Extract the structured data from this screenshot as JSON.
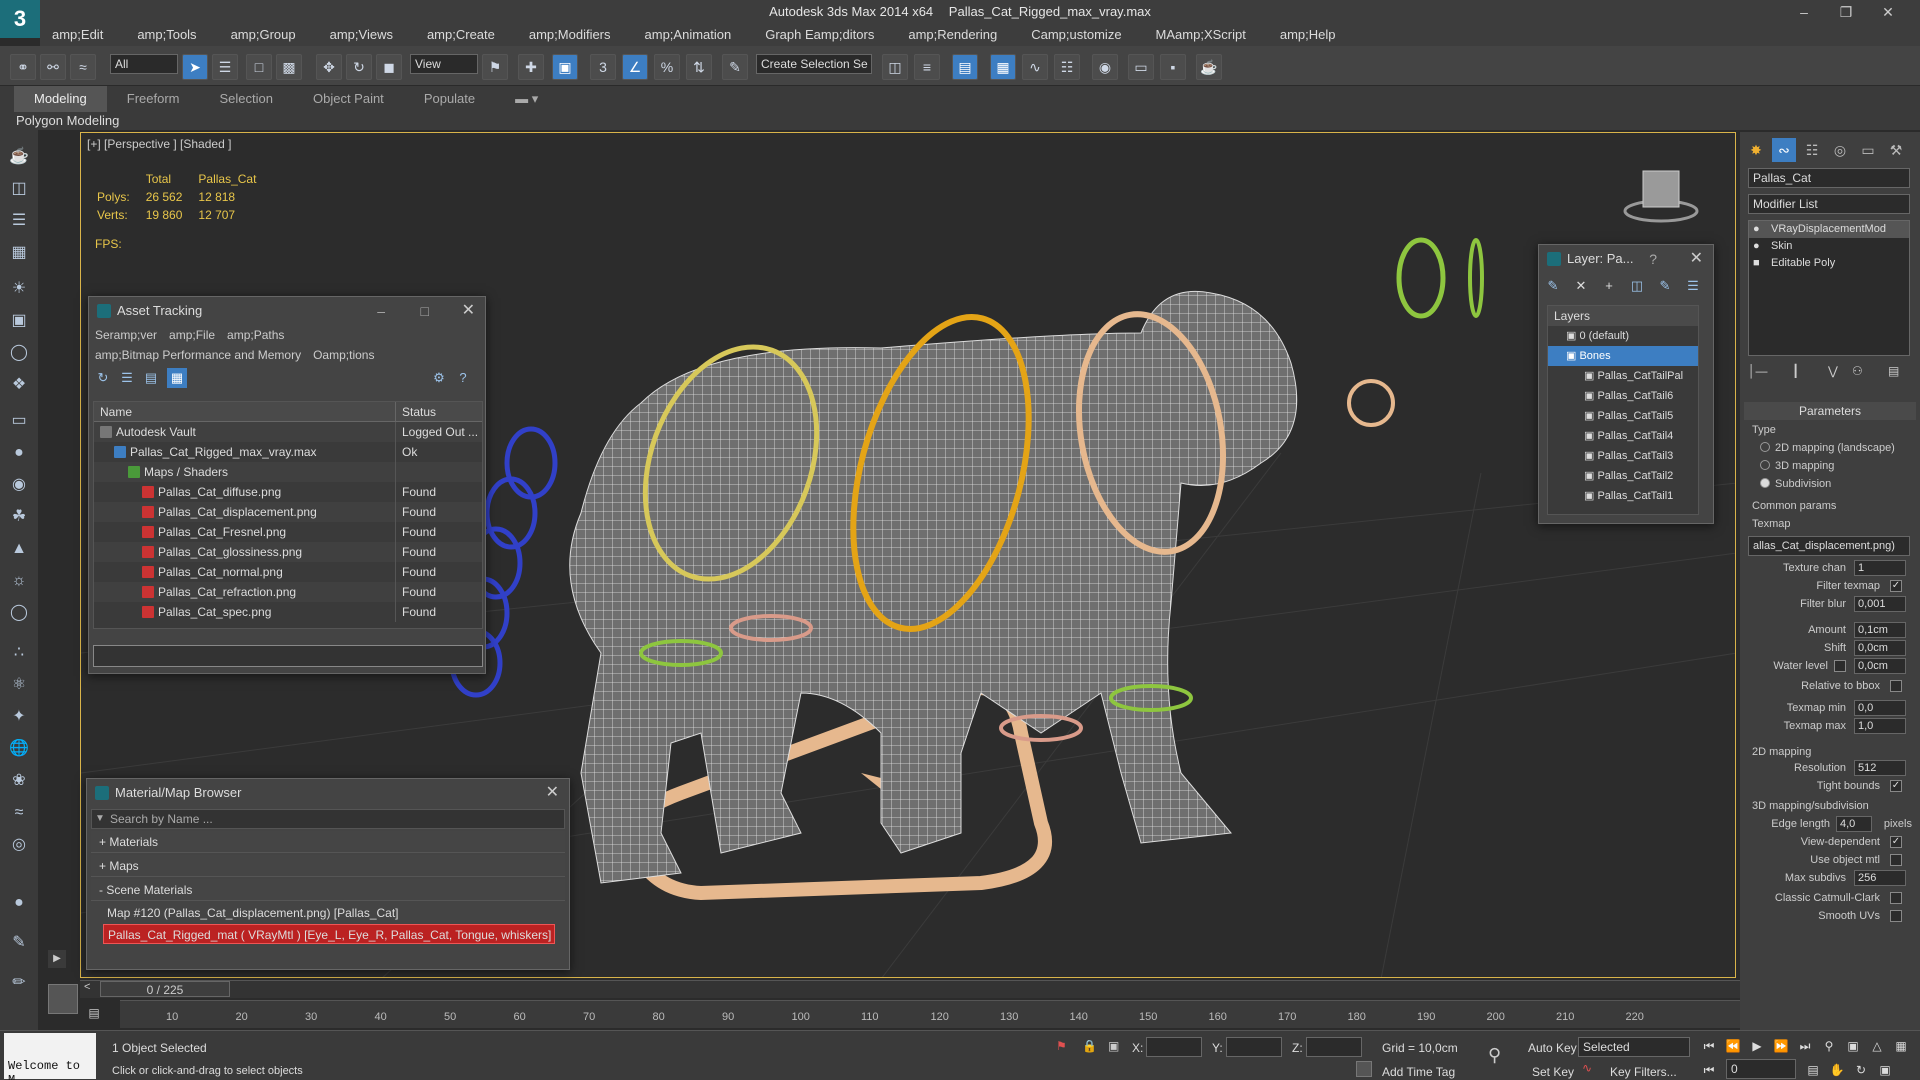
{
  "window": {
    "app_title": "Autodesk 3ds Max  2014 x64",
    "file_title": "Pallas_Cat_Rigged_max_vray.max",
    "logo": "3"
  },
  "menubar": [
    "amp;Edit",
    "amp;Tools",
    "amp;Group",
    "amp;Views",
    "amp;Create",
    "amp;Modifiers",
    "amp;Animation",
    "Graph Eamp;ditors",
    "amp;Rendering",
    "Camp;ustomize",
    "MAamp;XScript",
    "amp;Help"
  ],
  "toolbar": {
    "filter_select": "All",
    "coord_select": "View",
    "selection_set": "Create Selection Se"
  },
  "ribbon": {
    "tabs": [
      "Modeling",
      "Freeform",
      "Selection",
      "Object Paint",
      "Populate"
    ],
    "sub_label": "Polygon Modeling"
  },
  "viewport": {
    "label": "[+] [Perspective ] [Shaded ]",
    "stats": {
      "col_total": "Total",
      "col_object": "Pallas_Cat",
      "polys_label": "Polys:",
      "polys_total": "26 562",
      "polys_object": "12 818",
      "verts_label": "Verts:",
      "verts_total": "19 860",
      "verts_object": "12 707",
      "fps_label": "FPS:"
    }
  },
  "asset_tracking": {
    "title": "Asset Tracking",
    "menu": [
      "Seramp;ver",
      "amp;File",
      "amp;Paths",
      "amp;Bitmap Performance and Memory",
      "Oamp;tions"
    ],
    "columns": [
      "Name",
      "Status"
    ],
    "rows": [
      {
        "name": "Autodesk Vault",
        "status": "Logged Out ...",
        "indent": 0
      },
      {
        "name": "Pallas_Cat_Rigged_max_vray.max",
        "status": "Ok",
        "indent": 1
      },
      {
        "name": "Maps / Shaders",
        "status": "",
        "indent": 2
      },
      {
        "name": "Pallas_Cat_diffuse.png",
        "status": "Found",
        "indent": 3
      },
      {
        "name": "Pallas_Cat_displacement.png",
        "status": "Found",
        "indent": 3
      },
      {
        "name": "Pallas_Cat_Fresnel.png",
        "status": "Found",
        "indent": 3
      },
      {
        "name": "Pallas_Cat_glossiness.png",
        "status": "Found",
        "indent": 3
      },
      {
        "name": "Pallas_Cat_normal.png",
        "status": "Found",
        "indent": 3
      },
      {
        "name": "Pallas_Cat_refraction.png",
        "status": "Found",
        "indent": 3
      },
      {
        "name": "Pallas_Cat_spec.png",
        "status": "Found",
        "indent": 3
      }
    ]
  },
  "material_browser": {
    "title": "Material/Map Browser",
    "search_placeholder": "Search by Name ...",
    "groups": [
      "+ Materials",
      "+ Maps",
      "- Scene Materials"
    ],
    "entries": [
      "Map #120 (Pallas_Cat_displacement.png) [Pallas_Cat]",
      "Pallas_Cat_Rigged_mat ( VRayMtl ) [Eye_L, Eye_R, Pallas_Cat, Tongue, whiskers]"
    ]
  },
  "layer_panel": {
    "title": "Layer: Pa...",
    "help": "?",
    "header": "Layers",
    "items": [
      "0 (default)",
      "Bones",
      "Pallas_CatTailPal",
      "Pallas_CatTail6",
      "Pallas_CatTail5",
      "Pallas_CatTail4",
      "Pallas_CatTail3",
      "Pallas_CatTail2",
      "Pallas_CatTail1"
    ]
  },
  "command_panel": {
    "object_name": "Pallas_Cat",
    "modifier_list": "Modifier List",
    "stack": [
      "VRayDisplacementMod",
      "Skin",
      "Editable Poly"
    ],
    "parameters_title": "Parameters",
    "type_label": "Type",
    "type_options": [
      "2D mapping (landscape)",
      "3D mapping",
      "Subdivision"
    ],
    "type_selected": 2,
    "common_params": "Common params",
    "texmap_label": "Texmap",
    "texmap_value": "allas_Cat_displacement.png)",
    "texture_chan_label": "Texture chan",
    "texture_chan_value": "1",
    "filter_texmap_label": "Filter texmap",
    "filter_blur_label": "Filter blur",
    "filter_blur_value": "0,001",
    "amount_label": "Amount",
    "amount_value": "0,1cm",
    "shift_label": "Shift",
    "shift_value": "0,0cm",
    "water_level_label": "Water level",
    "water_level_value": "0,0cm",
    "relative_bbox_label": "Relative to bbox",
    "texmap_min_label": "Texmap min",
    "texmap_min_value": "0,0",
    "texmap_max_label": "Texmap max",
    "texmap_max_value": "1,0",
    "mapping_2d": "2D mapping",
    "resolution_label": "Resolution",
    "resolution_value": "512",
    "tight_bounds_label": "Tight bounds",
    "mapping_3d": "3D mapping/subdivision",
    "edge_length_label": "Edge length",
    "edge_length_value": "4,0",
    "pixels_label": "pixels",
    "view_dependent_label": "View-dependent",
    "use_object_mtl_label": "Use object mtl",
    "max_subdivs_label": "Max subdivs",
    "max_subdivs_value": "256",
    "classic_label": "Classic Catmull-Clark",
    "smooth_uvs_label": "Smooth UVs"
  },
  "timeline": {
    "frame_counter": "0 / 225",
    "ticks": [
      "10",
      "20",
      "30",
      "40",
      "50",
      "60",
      "70",
      "80",
      "90",
      "100",
      "110",
      "120",
      "130",
      "140",
      "150",
      "160",
      "170",
      "180",
      "190",
      "200",
      "210",
      "220"
    ]
  },
  "statusbar": {
    "welcome": "Welcome to M",
    "selected_count": "1 Object Selected",
    "prompt": "Click or click-and-drag to select objects",
    "x_label": "X:",
    "y_label": "Y:",
    "z_label": "Z:",
    "grid": "Grid = 10,0cm",
    "add_time_tag": "Add Time Tag",
    "auto_key": "Auto Key",
    "set_key": "Set Key",
    "key_mode": "Selected",
    "key_filters": "Key Filters...",
    "current_frame": "0"
  },
  "colors": {
    "accent_blue": "#3d7ec2",
    "viewport_border": "#d9b44a",
    "stats_yellow": "#e8c64a",
    "highlight_red": "#b22222"
  }
}
